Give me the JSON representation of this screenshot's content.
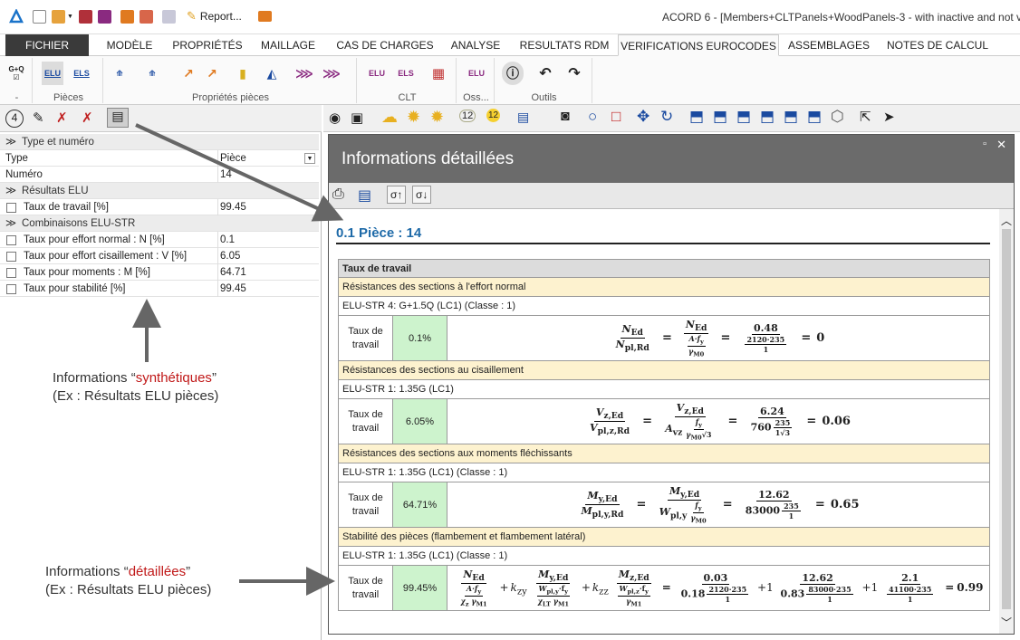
{
  "window": {
    "title": "ACORD 6 - [Members+CLTPanels+WoodPanels-3 - with inactive and not v",
    "report_label": "Report..."
  },
  "ribbon_tabs": [
    "FICHIER",
    "MODÈLE",
    "PROPRIÉTÉS",
    "MAILLAGE",
    "CAS DE CHARGES",
    "ANALYSE",
    "RESULTATS RDM",
    "VERIFICATIONS EUROCODES",
    "ASSEMBLAGES",
    "NOTES DE CALCUL"
  ],
  "ribbon": {
    "groups": [
      "-",
      "Pièces",
      "Propriétés pièces",
      "CLT",
      "Oss...",
      "Outils"
    ],
    "buttons": {
      "gq": "G+Q",
      "elu": "ELU",
      "els": "ELS",
      "clt_elu": "ELU",
      "clt_els": "ELS",
      "oss_elu": "ELU"
    }
  },
  "left_toolbar": {
    "count_badge": "4"
  },
  "properties": {
    "cat_type": "Type et numéro",
    "type_label": "Type",
    "type_value": "Pièce",
    "num_label": "Numéro",
    "num_value": "14",
    "cat_elu": "Résultats ELU",
    "taux_label": "Taux de travail [%]",
    "taux_value": "99.45",
    "cat_comb": "Combinaisons ELU-STR",
    "rows": [
      {
        "label": "Taux pour effort normal : N  [%]",
        "value": "0.1"
      },
      {
        "label": "Taux pour effort cisaillement : V  [%]",
        "value": "6.05"
      },
      {
        "label": "Taux pour moments : M  [%]",
        "value": "64.71"
      },
      {
        "label": "Taux pour stabilité [%]",
        "value": "99.45"
      }
    ]
  },
  "annotations": {
    "synth_a": "Informations “",
    "synth_red": "synthétiques",
    "synth_b": "”",
    "synth_sub": "(Ex : Résultats ELU pièces)",
    "det_a": "Informations “",
    "det_red": "détaillées",
    "det_b": "”",
    "det_sub": "(Ex : Résultats ELU pièces)"
  },
  "detail": {
    "title": "Informations détaillées",
    "piece_title": "0.1 Pièce : 14",
    "table_header": "Taux de travail",
    "work_label": "Taux de travail",
    "sections": [
      {
        "title": "Résistances des sections à l'effort normal",
        "comb": "ELU-STR 4: G+1.5Q (LC1) (Classe : 1)",
        "pct": "0.1%",
        "f": {
          "l_n": "N",
          "l_ns": "Ed",
          "l_d": "N",
          "l_ds": "pl,Rd",
          "m_n": "N",
          "m_ns": "Ed",
          "m_dn": "A·f",
          "m_dns": "y",
          "m_dd": "γ",
          "m_dds": "M0",
          "v_n": "0.48",
          "v_dn": "2120·235",
          "v_dd": "1",
          "res": "0"
        }
      },
      {
        "title": "Résistances des sections au cisaillement",
        "comb": "ELU-STR 1: 1.35G (LC1)",
        "pct": "6.05%",
        "f": {
          "l_n": "V",
          "l_ns": "z,Ed",
          "l_d": "V",
          "l_ds": "pl,z,Rd",
          "m_n": "V",
          "m_ns": "z,Ed",
          "m_d": "A",
          "m_ds": "vz",
          "m_dn": "f",
          "m_dns": "y",
          "m_dd": "γ",
          "m_dds": "M0",
          "m_sqrt": "√3",
          "v_n": "6.24",
          "v_d": "760",
          "v_dn": "235",
          "v_dd": "1√3",
          "res": "0.06"
        }
      },
      {
        "title": "Résistances des sections aux moments fléchissants",
        "comb": "ELU-STR 1: 1.35G (LC1) (Classe : 1)",
        "pct": "64.71%",
        "f": {
          "l_n": "M",
          "l_ns": "y,Ed",
          "l_d": "M",
          "l_ds": "pl,y,Rd",
          "m_n": "M",
          "m_ns": "y,Ed",
          "m_d": "W",
          "m_ds": "pl,y",
          "m_dn": "f",
          "m_dns": "y",
          "m_dd": "γ",
          "m_dds": "M0",
          "v_n": "12.62",
          "v_d": "83000",
          "v_dn": "235",
          "v_dd": "1",
          "res": "0.65"
        }
      },
      {
        "title": "Stabilité des pièces (flambement et flambement latéral)",
        "comb": "ELU-STR 1: 1.35G (LC1) (Classe : 1)",
        "pct": "99.45%",
        "f": {
          "t1_n": "N",
          "t1_ns": "Ed",
          "t1_dn": "A·f",
          "t1_dns": "y",
          "t1_chi": "χ",
          "t1_chis": "z",
          "t1_g": "γ",
          "t1_gs": "M1",
          "plus": "+",
          "kzy": "k",
          "kzys": "zy",
          "t2_n": "M",
          "t2_ns": "y,Ed",
          "t2_dn": "W",
          "t2_dns": "pl,y",
          "t2_f": "·f",
          "t2_fs": "y",
          "t2_chi": "χ",
          "t2_chis": "LT",
          "t2_g": "γ",
          "t2_gs": "M1",
          "kzz": "k",
          "kzzs": "zz",
          "t3_n": "M",
          "t3_ns": "z,Ed",
          "t3_dn": "W",
          "t3_dns": "pl,z",
          "t3_f": "·f",
          "t3_fs": "y",
          "t3_g": "γ",
          "t3_gs": "M1",
          "v1_n": "0.03",
          "v1_c": "0.18",
          "v1_dn": "2120·235",
          "v1_dd": "1",
          "v2_k": "1",
          "v2_n": "12.62",
          "v2_c": "0.83",
          "v2_dn": "83000·235",
          "v2_dd": "1",
          "v3_k": "1",
          "v3_n": "2.1",
          "v3_dn": "41100·235",
          "v3_dd": "1",
          "res": "0.99"
        }
      }
    ]
  }
}
